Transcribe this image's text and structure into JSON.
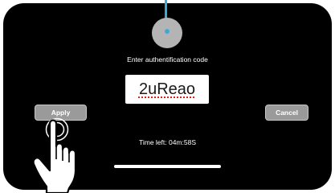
{
  "auth": {
    "prompt": "Enter authentification code",
    "code_value": "2uReao"
  },
  "buttons": {
    "apply_label": "Apply",
    "cancel_label": "Cancel"
  },
  "timer": {
    "text": "Time left: 04m:58S"
  },
  "icons": {
    "avatar": "user-avatar-circle",
    "hand": "tapping-hand-icon"
  },
  "colors": {
    "screen_background": "#000000",
    "accent": "#3fa9d6",
    "button": "#9a9a9a",
    "code_box": "#ffffff",
    "spellcheck_underline": "#e02020"
  }
}
